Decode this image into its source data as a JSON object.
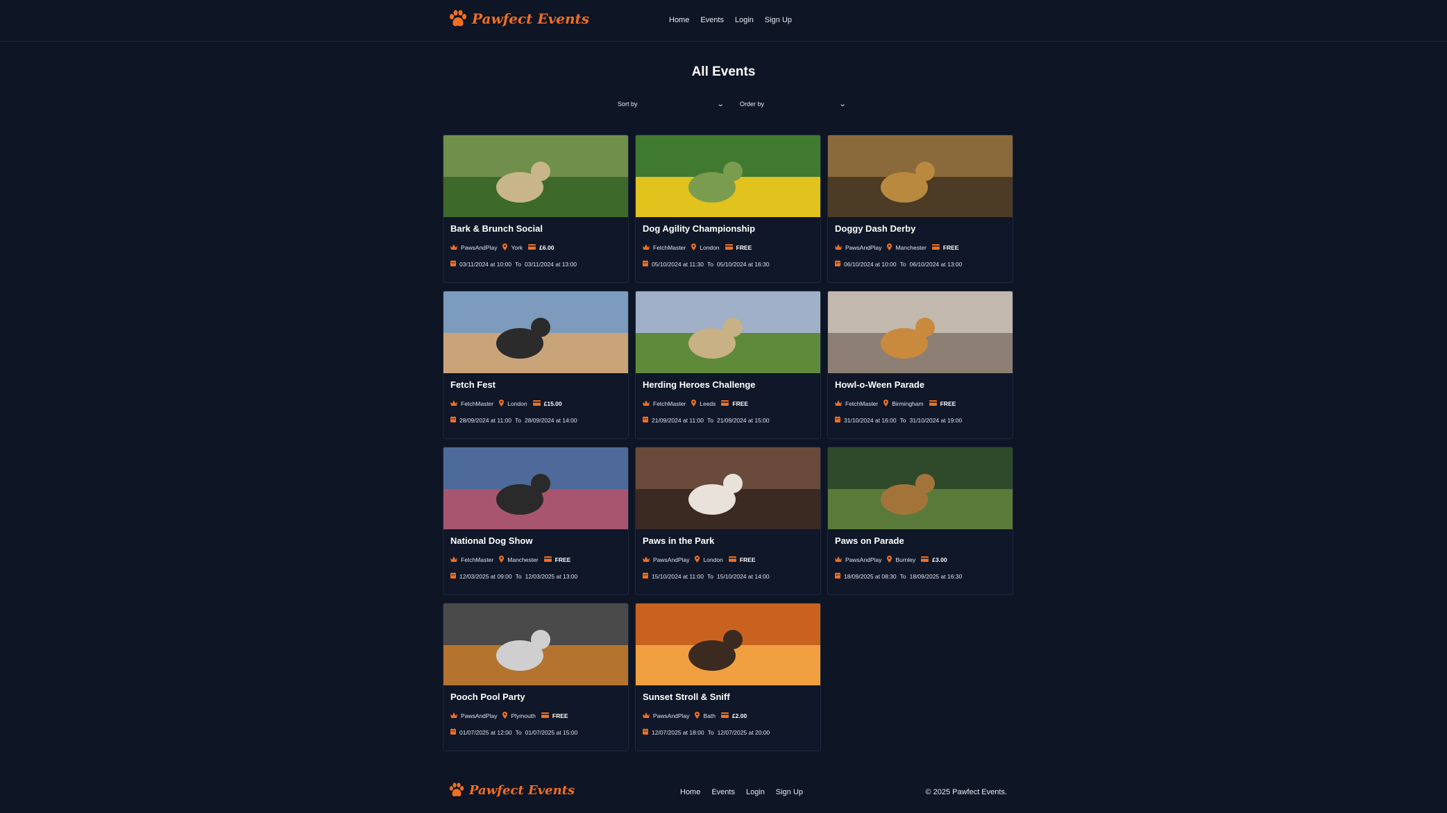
{
  "brand": {
    "name": "Pawfect Events",
    "accent": "#f16f23",
    "background": "#0e1525"
  },
  "nav": [
    "Home",
    "Events",
    "Login",
    "Sign Up"
  ],
  "page": {
    "title": "All Events"
  },
  "filters": {
    "sort_label": "Sort by",
    "order_label": "Order by"
  },
  "events": [
    {
      "title": "Bark & Brunch Social",
      "organizer": "PawsAndPlay",
      "location": "York",
      "price": "£6.00",
      "start": "03/11/2024 at 10:00",
      "end": "03/11/2024 at 13:00"
    },
    {
      "title": "Dog Agility Championship",
      "organizer": "FetchMaster",
      "location": "London",
      "price": "FREE",
      "start": "05/10/2024 at 11:30",
      "end": "05/10/2024 at 16:30"
    },
    {
      "title": "Doggy Dash Derby",
      "organizer": "PawsAndPlay",
      "location": "Manchester",
      "price": "FREE",
      "start": "06/10/2024 at 10:00",
      "end": "06/10/2024 at 13:00"
    },
    {
      "title": "Fetch Fest",
      "organizer": "FetchMaster",
      "location": "London",
      "price": "£15.00",
      "start": "28/09/2024 at 11:00",
      "end": "28/09/2024 at 14:00"
    },
    {
      "title": "Herding Heroes Challenge",
      "organizer": "FetchMaster",
      "location": "Leeds",
      "price": "FREE",
      "start": "21/09/2024 at 11:00",
      "end": "21/09/2024 at 15:00"
    },
    {
      "title": "Howl-o-Ween Parade",
      "organizer": "FetchMaster",
      "location": "Birmingham",
      "price": "FREE",
      "start": "31/10/2024 at 16:00",
      "end": "31/10/2024 at 19:00"
    },
    {
      "title": "National Dog Show",
      "organizer": "FetchMaster",
      "location": "Manchester",
      "price": "FREE",
      "start": "12/03/2025 at 09:00",
      "end": "12/03/2025 at 13:00"
    },
    {
      "title": "Paws in the Park",
      "organizer": "PawsAndPlay",
      "location": "London",
      "price": "FREE",
      "start": "15/10/2024 at 11:00",
      "end": "15/10/2024 at 14:00"
    },
    {
      "title": "Paws on Parade",
      "organizer": "PawsAndPlay",
      "location": "Burnley",
      "price": "£3.00",
      "start": "18/09/2025 at 08:30",
      "end": "18/09/2025 at 16:30"
    },
    {
      "title": "Pooch Pool Party",
      "organizer": "PawsAndPlay",
      "location": "Plymouth",
      "price": "FREE",
      "start": "01/07/2025 at 12:00",
      "end": "01/07/2025 at 15:00"
    },
    {
      "title": "Sunset Stroll & Sniff",
      "organizer": "PawsAndPlay",
      "location": "Bath",
      "price": "£2.00",
      "start": "12/07/2025 at 18:00",
      "end": "12/07/2025 at 20:00"
    }
  ],
  "date_separator": "To",
  "footer": {
    "copyright": "© 2025 Pawfect Events."
  }
}
